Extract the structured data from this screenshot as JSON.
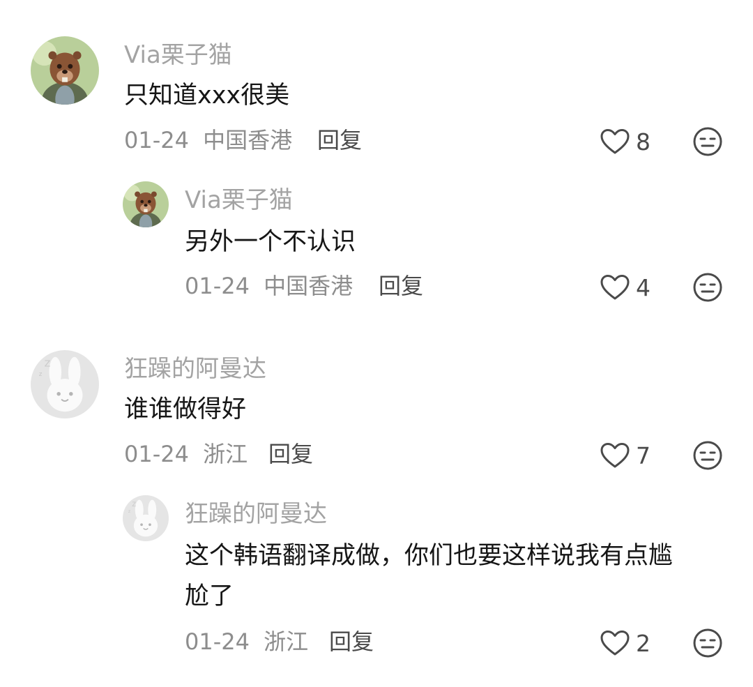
{
  "comments": [
    {
      "username": "Via栗子猫",
      "text": "只知道xxx很美",
      "date": "01-24",
      "location": "中国香港",
      "reply_label": "回复",
      "likes": "8",
      "avatar": "beaver-avatar-icon"
    },
    {
      "username": "Via栗子猫",
      "text": "另外一个不认识",
      "date": "01-24",
      "location": "中国香港",
      "reply_label": "回复",
      "likes": "4",
      "avatar": "beaver-avatar-icon"
    },
    {
      "username": "狂躁的阿曼达",
      "text": "谁谁做得好",
      "date": "01-24",
      "location": "浙江",
      "reply_label": "回复",
      "likes": "7",
      "avatar": "bunny-avatar-icon"
    },
    {
      "username": "狂躁的阿曼达",
      "text_line1": "这个韩语翻译成做，你们也要这样说我有点尴",
      "text_line2": "尬了",
      "date": "01-24",
      "location": "浙江",
      "reply_label": "回复",
      "likes": "2",
      "avatar": "bunny-avatar-icon"
    }
  ],
  "colors": {
    "username": "#a3a3a3",
    "text": "#161616",
    "meta": "#8d8d8d",
    "icon": "#4a4a4a"
  }
}
